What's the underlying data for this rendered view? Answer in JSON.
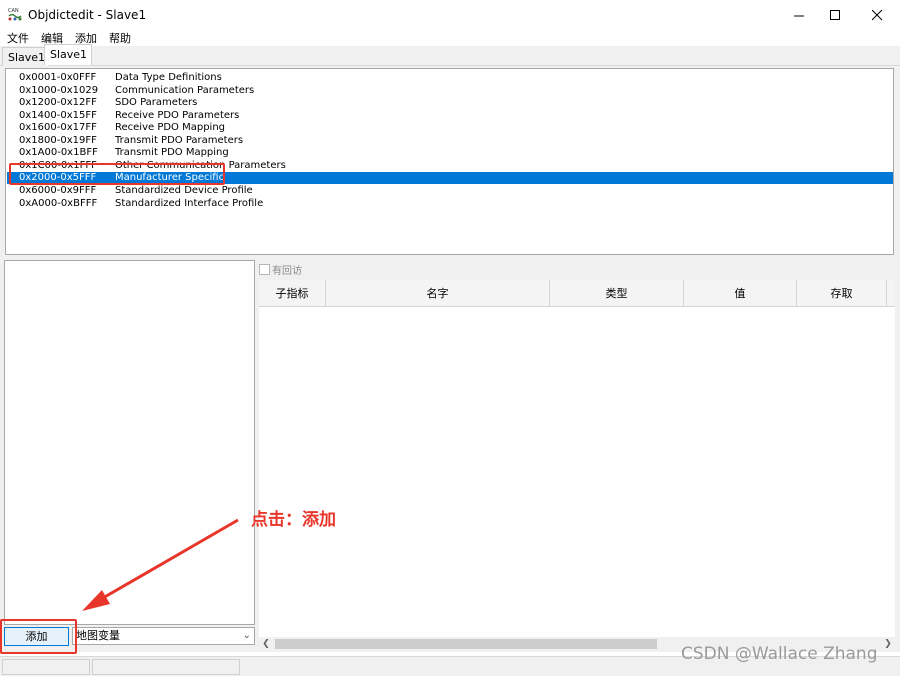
{
  "window": {
    "title": "Objdictedit - Slave1",
    "icon_label": "CAN",
    "controls": [
      "minimize-icon",
      "maximize-icon",
      "close-icon"
    ]
  },
  "menubar": {
    "items": [
      "文件",
      "编辑",
      "添加",
      "帮助"
    ]
  },
  "tabs": [
    {
      "label": "Slave1",
      "active": false
    },
    {
      "label": "Slave1",
      "active": true
    }
  ],
  "index_ranges": [
    {
      "addr": "0x0001-0x0FFF",
      "desc": "Data Type Definitions"
    },
    {
      "addr": "0x1000-0x1029",
      "desc": "Communication Parameters"
    },
    {
      "addr": "0x1200-0x12FF",
      "desc": "SDO Parameters"
    },
    {
      "addr": "0x1400-0x15FF",
      "desc": "Receive PDO Parameters"
    },
    {
      "addr": "0x1600-0x17FF",
      "desc": "Receive PDO Mapping"
    },
    {
      "addr": "0x1800-0x19FF",
      "desc": "Transmit PDO Parameters"
    },
    {
      "addr": "0x1A00-0x1BFF",
      "desc": "Transmit PDO Mapping"
    },
    {
      "addr": "0x1C00-0x1FFF",
      "desc": "Other Communication Parameters"
    },
    {
      "addr": "0x2000-0x5FFF",
      "desc": "Manufacturer Specific",
      "selected": true
    },
    {
      "addr": "0x6000-0x9FFF",
      "desc": "Standardized Device Profile"
    },
    {
      "addr": "0xA000-0xBFFF",
      "desc": "Standardized Interface Profile"
    }
  ],
  "bottom": {
    "callback_label": "有回访",
    "columns": [
      "子指标",
      "名字",
      "类型",
      "值",
      "存取"
    ],
    "add_button": "添加",
    "map_select_value": "地图变量"
  },
  "annotation": {
    "text": "点击：添加",
    "color": "#e8362b"
  },
  "watermark": "CSDN @Wallace Zhang",
  "colors": {
    "selection": "#0078d7",
    "annotation": "#e8362b"
  }
}
